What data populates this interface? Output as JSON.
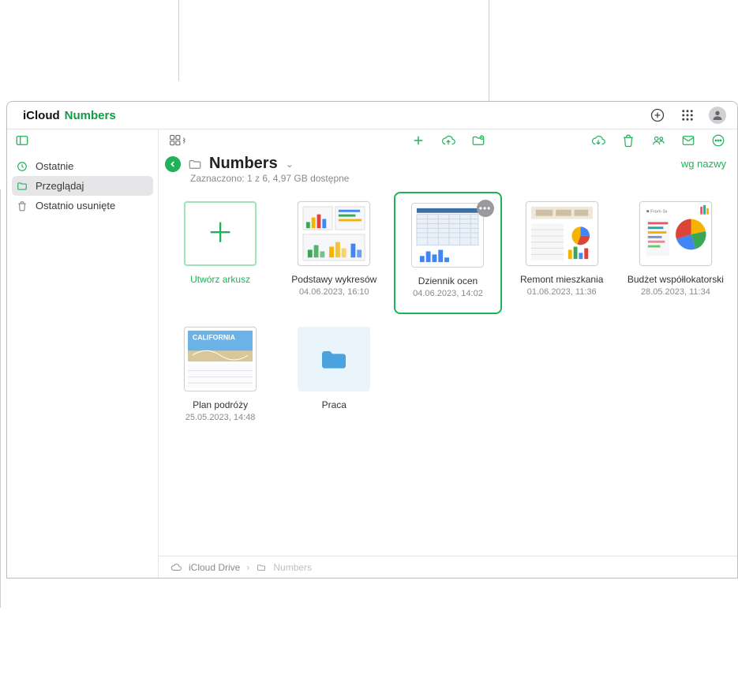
{
  "brand": {
    "icloud_label": "iCloud",
    "app_label": "Numbers"
  },
  "sidebar": {
    "items": [
      {
        "icon": "clock",
        "label": "Ostatnie"
      },
      {
        "icon": "folder",
        "label": "Przeglądaj"
      },
      {
        "icon": "trash",
        "label": "Ostatnio usunięte"
      }
    ],
    "active_index": 1
  },
  "location": {
    "name": "Numbers"
  },
  "status": {
    "text": "Zaznaczono: 1 z 6, 4,97 GB dostępne"
  },
  "sort": {
    "label": "wg nazwy"
  },
  "create": {
    "label": "Utwórz arkusz"
  },
  "items": [
    {
      "title": "Podstawy wykresów",
      "date": "04.06.2023, 16:10",
      "kind": "doc",
      "thumb": "charts"
    },
    {
      "title": "Dziennik ocen",
      "date": "04.06.2023, 14:02",
      "kind": "doc",
      "thumb": "table",
      "selected": true
    },
    {
      "title": "Remont mieszkania",
      "date": "01.06.2023, 11:36",
      "kind": "doc",
      "thumb": "mixed"
    },
    {
      "title": "Budżet współlokatorski",
      "date": "28.05.2023, 11:34",
      "kind": "doc",
      "thumb": "pie"
    },
    {
      "title": "Plan podróży",
      "date": "25.05.2023, 14:48",
      "kind": "doc",
      "thumb": "photo"
    },
    {
      "title": "Praca",
      "kind": "folder"
    }
  ],
  "breadcrumbs": [
    {
      "icon": "cloud",
      "label": "iCloud Drive"
    },
    {
      "icon": "folder",
      "label": "Numbers"
    }
  ]
}
